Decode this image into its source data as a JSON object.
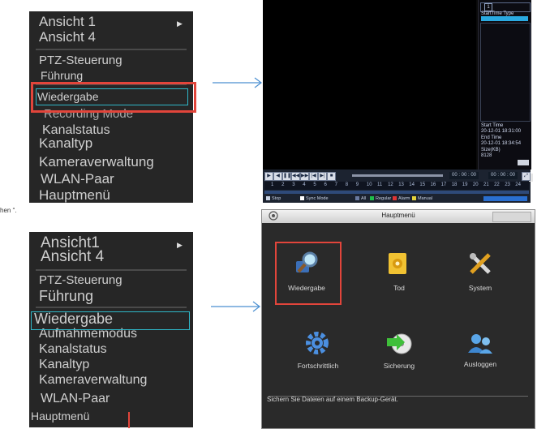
{
  "caption": "hen “.",
  "menu_top": {
    "items": [
      {
        "label": "Ansicht 1"
      },
      {
        "label": "Ansicht 4"
      },
      {
        "label": "PTZ-Steuerung"
      },
      {
        "label": "Führung"
      },
      {
        "label": "Wiedergabe"
      },
      {
        "label": "Recording Mode"
      },
      {
        "label": "Kanalstatus"
      },
      {
        "label": "Kanaltyp"
      },
      {
        "label": "Kameraverwaltung"
      },
      {
        "label": "WLAN-Paar"
      },
      {
        "label": "Hauptmenü"
      }
    ]
  },
  "menu_bottom": {
    "items": [
      {
        "label": "Ansicht1"
      },
      {
        "label": "Ansicht 4"
      },
      {
        "label": "PTZ-Steuerung"
      },
      {
        "label": "Führung"
      },
      {
        "label": "Wiedergabe"
      },
      {
        "label": "Aufnahmemodus"
      },
      {
        "label": "Kanalstatus"
      },
      {
        "label": "Kanaltyp"
      },
      {
        "label": "Kameraverwaltung"
      },
      {
        "label": "WLAN-Paar"
      },
      {
        "label": "Hauptmenü"
      }
    ]
  },
  "playback": {
    "calendar_day": "1",
    "file_list_header": "StartTime Type",
    "start_time_label": "Start Time",
    "start_time_value": "20-12-01 18:31:00",
    "end_time_label": "End Time",
    "end_time_value": "20-12-01 18:34:54",
    "size_label": "Size(KB)",
    "size_value": "8128",
    "time_left": "00 : 00 : 00",
    "time_right": "00 : 00 : 00",
    "timeline_hours": [
      "1",
      "2",
      "3",
      "4",
      "5",
      "6",
      "7",
      "8",
      "9",
      "10",
      "11",
      "12",
      "13",
      "14",
      "15",
      "16",
      "17",
      "18",
      "19",
      "20",
      "21",
      "22",
      "23",
      "24"
    ],
    "legend": {
      "stop": "Stop",
      "sync_mode": "Sync Mode",
      "all": "All",
      "regular": "Regular",
      "alarm": "Alarm",
      "manual": "Manual"
    },
    "colors": {
      "regular": "#1fbf4b",
      "alarm": "#e03434",
      "manual": "#e3d13a",
      "all": "#6a7aa0"
    }
  },
  "main_menu": {
    "title": "Hauptmenü",
    "tiles": [
      {
        "label": "Wiedergabe",
        "icon": "playback-search-icon"
      },
      {
        "label": "Tod",
        "icon": "record-icon"
      },
      {
        "label": "System",
        "icon": "tools-icon"
      },
      {
        "label": "Fortschrittlich",
        "icon": "gear-icon"
      },
      {
        "label": "Sicherung",
        "icon": "backup-disc-icon"
      },
      {
        "label": "Ausloggen",
        "icon": "logout-user-icon"
      }
    ],
    "status_text": "Sichern Sie Dateien auf einem Backup-Gerät."
  }
}
